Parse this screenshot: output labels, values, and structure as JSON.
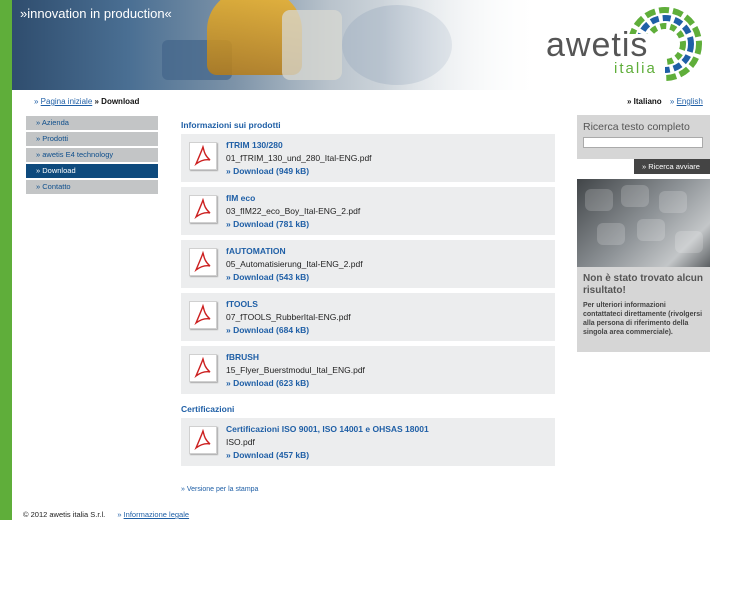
{
  "header": {
    "tagline": "»innovation in production«",
    "logo": {
      "name": "awetis",
      "sub": "italia"
    }
  },
  "breadcrumb": {
    "home_label": "Pagina iniziale",
    "current_label": "» Download"
  },
  "language": {
    "current": "» Italiano",
    "other": "English"
  },
  "nav": {
    "items": [
      {
        "label": "» Azienda"
      },
      {
        "label": "» Prodotti"
      },
      {
        "label": "» awetis E4 technology"
      },
      {
        "label": "» Download"
      },
      {
        "label": "» Contatto"
      }
    ]
  },
  "main": {
    "products_title": "Informazioni sui prodotti",
    "downloads": [
      {
        "title": "fTRIM 130/280",
        "file": "01_fTRIM_130_und_280_Ital-ENG.pdf",
        "link": "» Download (949 kB)"
      },
      {
        "title": "fIM eco",
        "file": "03_fIM22_eco_Boy_Ital-ENG_2.pdf",
        "link": "» Download (781 kB)"
      },
      {
        "title": "fAUTOMATION",
        "file": "05_Automatisierung_Ital-ENG_2.pdf",
        "link": "» Download (543 kB)"
      },
      {
        "title": "fTOOLS",
        "file": "07_fTOOLS_RubberItal-ENG.pdf",
        "link": "» Download (684 kB)"
      },
      {
        "title": "fBRUSH",
        "file": "15_Flyer_Buerstmodul_Ital_ENG.pdf",
        "link": "» Download (623 kB)"
      }
    ],
    "cert_title": "Certificazioni",
    "certs": [
      {
        "title": "Certificazioni ISO 9001, ISO 14001 e OHSAS 18001",
        "file": "ISO.pdf",
        "link": "» Download (457 kB)"
      }
    ],
    "print_label": "» Versione per la stampa"
  },
  "sidebar": {
    "search_title": "Ricerca testo completo",
    "search_value": "",
    "search_button": "» Ricerca avviare",
    "teaser_title": "Non è stato trovato alcun risultato!",
    "teaser_body": "Per ulteriori informazioni contattateci direttamente (rivolgersi alla persona di riferimento della singola area commerciale)."
  },
  "footer": {
    "copyright": "© 2012 awetis italia S.r.l.",
    "legal_prefix": "» ",
    "legal_link": "Informazione legale"
  },
  "colors": {
    "accent_blue": "#1f5fa6",
    "green": "#5fae3a",
    "nav_active": "#0e4a7d",
    "nav_bg": "#c3c5c6"
  },
  "icons": [
    "pdf-icon",
    "awetis-logo"
  ]
}
